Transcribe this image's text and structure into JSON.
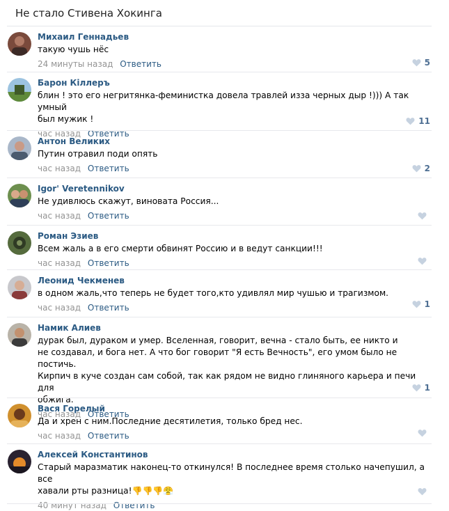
{
  "post": {
    "title": "Не стало Стивена Хокинга"
  },
  "comments": [
    {
      "author": "Михаил Геннадьев",
      "text": "такую чушь нёс",
      "time": "24 минуты назад",
      "reply": "Ответить",
      "likes": "5"
    },
    {
      "author": "Барон Кіллеръ",
      "text": "блин ! это его негритянка-феминистка довела травлей изза черных дыр !))) А так умный\nбыл мужик !",
      "time": "час назад",
      "reply": "Ответить",
      "likes": "11"
    },
    {
      "author": "Антон Великих",
      "text": "Путин отравил поди опять",
      "time": "час назад",
      "reply": "Ответить",
      "likes": "2"
    },
    {
      "author": "Igor' Veretennikov",
      "text": "Не удивлюсь скажут, виновата Россия...",
      "time": "час назад",
      "reply": "Ответить",
      "likes": ""
    },
    {
      "author": "Роман Эзиев",
      "text": "Всем жаль а в его смерти обвинят Россию и в ведут санкции!!!",
      "time": "час назад",
      "reply": "Ответить",
      "likes": ""
    },
    {
      "author": "Леонид Чекменев",
      "text": "в одном жаль,что теперь не будет того,кто удивлял мир чушью и трагизмом.",
      "time": "час назад",
      "reply": "Ответить",
      "likes": "1"
    },
    {
      "author": "Намик Алиев",
      "text": "дурак был, дураком и умер. Вселенная, говорит, вечна - стало быть, ее никто и\nне создавал, и бога нет. А что бог говорит \"Я есть Вечность\", его умом было не постичь.\nКирпич в куче создан сам собой, так как рядом не видно глиняного карьера и печи для\nобжига.",
      "time": "час назад",
      "reply": "Ответить",
      "likes": "1"
    },
    {
      "author": "Вася Горелый",
      "text": "Да и хрен с ним.Последние десятилетия, только бред нес.",
      "time": "час назад",
      "reply": "Ответить",
      "likes": ""
    },
    {
      "author": "Алексей Константинов",
      "text": "Старый маразматик наконец-то откинулся! В последнее время столько начепушил, а все\nхавали рты разница!",
      "time": "40 минут назад",
      "reply": "Ответить",
      "likes": ""
    }
  ],
  "icons": {
    "like": "heart-icon",
    "emoji_thumbs_down": "thumbs-down-emoji",
    "emoji_angry": "angry-face-emoji"
  },
  "colors": {
    "link": "#2b5a83",
    "meta": "#939393",
    "like": "#c6d2e0",
    "like_count": "#4e6f93",
    "separator": "#e7e8ec"
  }
}
